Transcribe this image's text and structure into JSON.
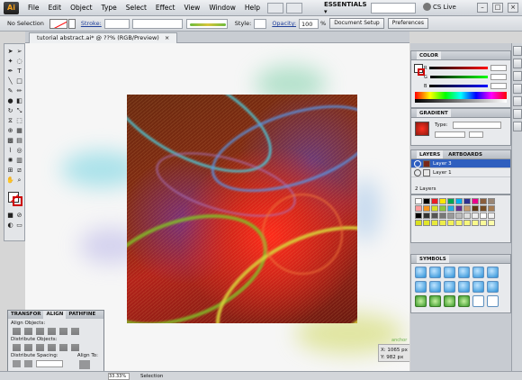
{
  "app": {
    "logo": "Ai"
  },
  "menu": [
    "File",
    "Edit",
    "Object",
    "Type",
    "Select",
    "Effect",
    "View",
    "Window",
    "Help"
  ],
  "workspace": "ESSENTIALS ▾",
  "cslive": "CS Live",
  "control": {
    "selection": "No Selection",
    "stroke_label": "Stroke:",
    "style_label": "Style:",
    "opacity_label": "Opacity:",
    "opacity_value": "100",
    "opacity_unit": "%",
    "doc_setup": "Document Setup",
    "preferences": "Preferences"
  },
  "document_tab": {
    "title": "tutorial abstract.ai* @ ??% (RGB/Preview)",
    "close": "×"
  },
  "canvas": {
    "anchor_label": "anchor",
    "coord_x": "X: 1065 px",
    "coord_y": "Y: 982 px"
  },
  "panels": {
    "color": {
      "title": "COLOR",
      "r": "R",
      "g": "G",
      "b": "B"
    },
    "gradient": {
      "title": "GRADIENT",
      "type_label": "Type:"
    },
    "layers": {
      "tabs": [
        "LAYERS",
        "ARTBOARDS"
      ],
      "rows": [
        {
          "name": "Layer 3",
          "selected": true
        },
        {
          "name": "Layer 1",
          "selected": false
        }
      ],
      "count": "2 Layers"
    },
    "symbols": {
      "title": "SYMBOLS"
    }
  },
  "align_panel": {
    "tabs": [
      "TRANSFOR",
      "ALIGN",
      "PATHFINE"
    ],
    "align_objects": "Align Objects:",
    "distribute_objects": "Distribute Objects:",
    "distribute_spacing": "Distribute Spacing:",
    "align_to": "Align To:"
  },
  "status": {
    "zoom": "33.33%",
    "mode": "Selection"
  },
  "colors": {
    "accent": "#2f5fbf",
    "ui_bg": "#d6d6d6",
    "art_red": "#d8261a",
    "art_cyan": "#4dc9d9",
    "art_yellow": "#d9d23a"
  }
}
